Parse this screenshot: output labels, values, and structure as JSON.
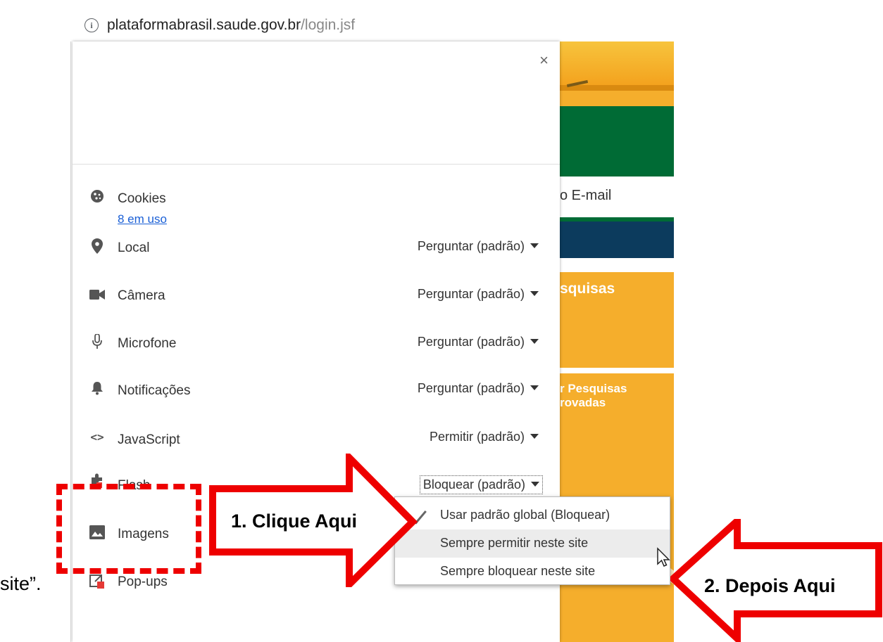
{
  "browser": {
    "url_host": "plataformabrasil.saude.gov.br",
    "url_path": "/login.jsf",
    "info_icon": "info-icon"
  },
  "background_site": {
    "email_text": "o E-mail",
    "pesquisas_text": "squisas",
    "pesquisas_aprovadas_line1": "r Pesquisas",
    "pesquisas_aprovadas_line2": "rovadas",
    "colors": {
      "orange": "#f5ae2c",
      "green": "#006b35",
      "navy": "#0c3b5d"
    }
  },
  "popup": {
    "close_label": "×",
    "cookies": {
      "label": "Cookies",
      "link": "8 em uso",
      "icon": "cookie-icon"
    },
    "permissions": [
      {
        "label": "Local",
        "value": "Perguntar (padrão)",
        "icon": "location-pin-icon"
      },
      {
        "label": "Câmera",
        "value": "Perguntar (padrão)",
        "icon": "camera-icon"
      },
      {
        "label": "Microfone",
        "value": "Perguntar (padrão)",
        "icon": "microphone-icon"
      },
      {
        "label": "Notificações",
        "value": "Perguntar (padrão)",
        "icon": "bell-icon"
      },
      {
        "label": "JavaScript",
        "value": "Permitir (padrão)",
        "icon": "code-icon"
      },
      {
        "label": "Flash",
        "value": "Bloquear (padrão)",
        "icon": "puzzle-icon"
      },
      {
        "label": "Imagens",
        "value": "",
        "icon": "image-icon"
      },
      {
        "label": "Pop-ups",
        "value": "",
        "icon": "popup-blocked-icon"
      }
    ]
  },
  "dropdown_menu": {
    "items": [
      {
        "label": "Usar padrão global (Bloquear)",
        "checked": true
      },
      {
        "label": "Sempre permitir neste site",
        "highlighted": true
      },
      {
        "label": "Sempre bloquear neste site"
      }
    ]
  },
  "annotations": {
    "step1": "1.  Clique Aqui",
    "step2": "2.  Depois Aqui",
    "color": "#ee0000"
  },
  "page_text": {
    "site_end": "site”."
  }
}
